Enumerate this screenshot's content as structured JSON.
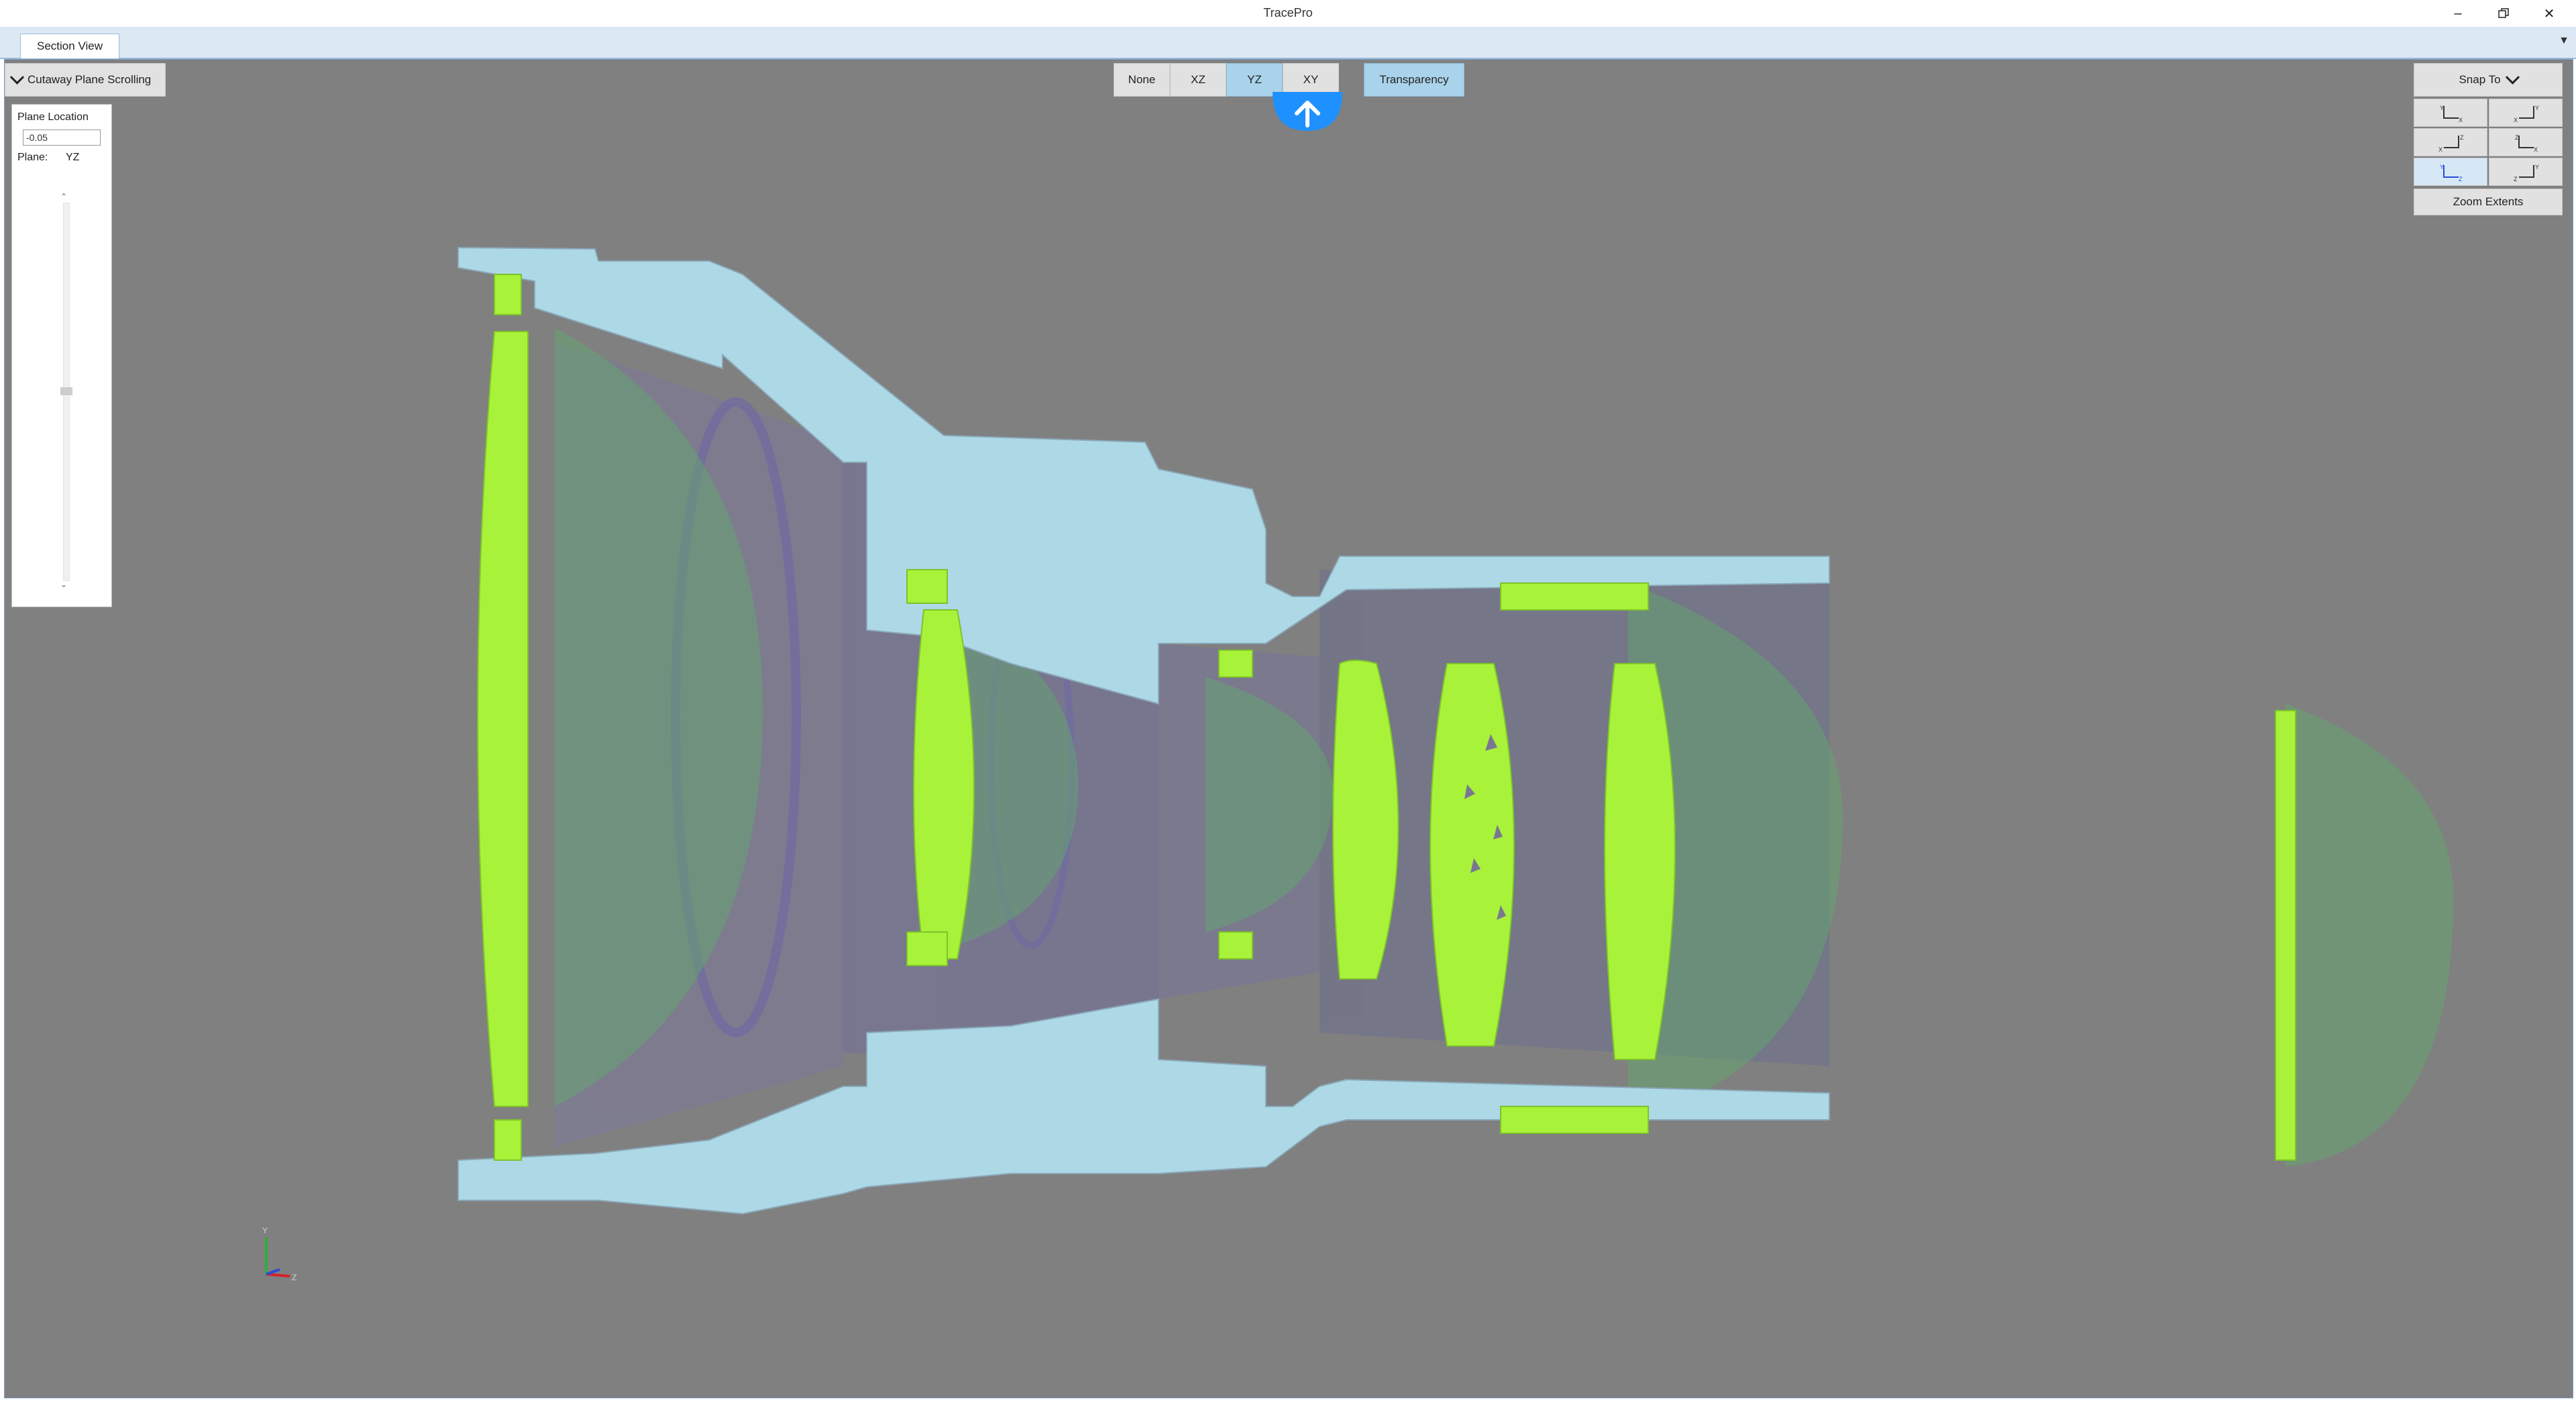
{
  "window": {
    "title": "TracePro",
    "minimize_icon": "minimize-icon",
    "restore_icon": "restore-icon",
    "close_icon": "close-icon"
  },
  "tabs": [
    {
      "label": "Section View",
      "active": true
    }
  ],
  "cutaway": {
    "label": "Cutaway Plane Scrolling",
    "expanded": true
  },
  "plane_buttons": [
    {
      "label": "None",
      "active": false
    },
    {
      "label": "XZ",
      "active": false
    },
    {
      "label": "YZ",
      "active": true
    },
    {
      "label": "XY",
      "active": false
    }
  ],
  "transparency": {
    "label": "Transparency",
    "active": true
  },
  "plane_panel": {
    "location_label": "Plane Location",
    "location_value": "-0.05",
    "plane_label": "Plane:",
    "plane_value": "YZ",
    "slider_position": 0.5
  },
  "snap": {
    "label": "Snap To",
    "views": [
      {
        "icon": "view-yx-icon",
        "axes": [
          "Y",
          "X"
        ]
      },
      {
        "icon": "view-xy-icon",
        "axes": [
          "Y",
          "X"
        ]
      },
      {
        "icon": "view-zx-icon",
        "axes": [
          "Z",
          "X"
        ]
      },
      {
        "icon": "view-xz-icon",
        "axes": [
          "Z",
          "X"
        ]
      },
      {
        "icon": "view-yz-icon",
        "axes": [
          "Y",
          "Z"
        ],
        "active": true
      },
      {
        "icon": "view-zy-icon",
        "axes": [
          "Y",
          "Z"
        ]
      }
    ],
    "zoom_extents": "Zoom Extents"
  },
  "axis_triad": {
    "labels": [
      "Y",
      "Z"
    ]
  },
  "colors": {
    "viewport_bg": "#808080",
    "lens_section": "#a8f23a",
    "housing_section": "#add8e6",
    "housing_body": "#7a7a96",
    "accent": "#1e90ff"
  }
}
